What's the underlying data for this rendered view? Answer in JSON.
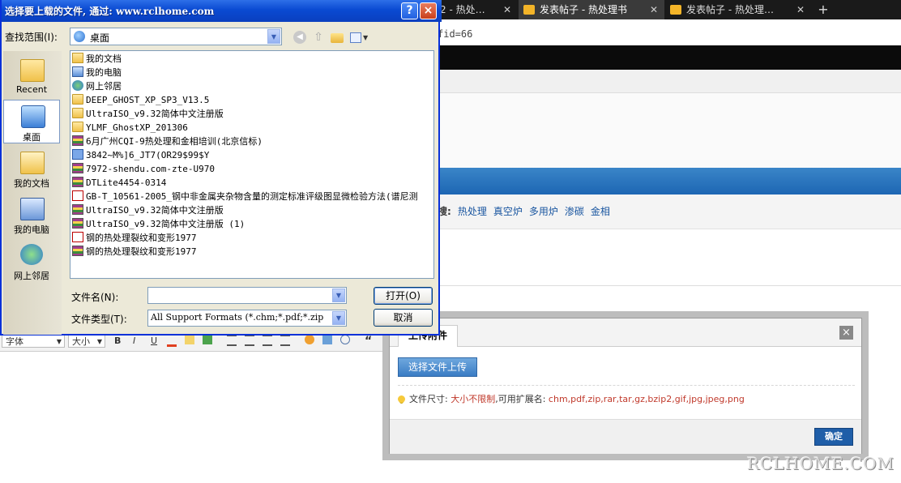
{
  "browser": {
    "tabs": [
      {
        "label": "2 - 热处…",
        "active": false
      },
      {
        "label": "发表帖子 - 热处理书",
        "active": true
      },
      {
        "label": "发表帖子 - 热处理…",
        "active": false
      }
    ],
    "new_tab": "+",
    "address_fragment": "fid=66"
  },
  "page": {
    "tags_label": "搜:",
    "tags": [
      "热处理",
      "真空炉",
      "多用炉",
      "渗碳",
      "金相"
    ],
    "editor_toolbar": {
      "font": "字体",
      "size": "大小",
      "bold": "B",
      "italic": "I",
      "underline": "U",
      "quote": "“"
    }
  },
  "upload_popup": {
    "tab_label": "上传附件",
    "close": "×",
    "select_button": "选择文件上传",
    "size_label": "文件尺寸:",
    "size_value": "大小不限制",
    "ext_label": ",可用扩展名:",
    "ext_value": "chm,pdf,zip,rar,tar,gz,bzip2,gif,jpg,jpeg,png",
    "ok_button": "确定"
  },
  "dialog": {
    "title": "选择要上载的文件, 通过: www.rclhome.com",
    "help": "?",
    "close": "×",
    "lookin_label": "查找范围(I):",
    "lookin_value": "桌面",
    "places": [
      {
        "label": "Recent",
        "icon": "recent-folder-icon"
      },
      {
        "label": "桌面",
        "icon": "desktop-icon",
        "selected": true
      },
      {
        "label": "我的文档",
        "icon": "my-documents-icon"
      },
      {
        "label": "我的电脑",
        "icon": "my-computer-icon"
      },
      {
        "label": "网上邻居",
        "icon": "network-icon"
      }
    ],
    "files": [
      {
        "name": "我的文档",
        "icon": "mydocs"
      },
      {
        "name": "我的电脑",
        "icon": "computer"
      },
      {
        "name": "网上邻居",
        "icon": "network"
      },
      {
        "name": "DEEP_GHOST_XP_SP3_V13.5",
        "icon": "folder"
      },
      {
        "name": "UltraISO_v9.32简体中文注册版",
        "icon": "folder"
      },
      {
        "name": "YLMF_GhostXP_201306",
        "icon": "folder"
      },
      {
        "name": "6月广州CQI-9热处理和金相培训(北京信标)",
        "icon": "archive"
      },
      {
        "name": "3842~M%]6_JT7(OR29$99$Y",
        "icon": "jpg"
      },
      {
        "name": "7972-shendu.com-zte-U970",
        "icon": "archive"
      },
      {
        "name": "DTLite4454-0314",
        "icon": "archive"
      },
      {
        "name": "GB-T_10561-2005_钢中非金属夹杂物含量的测定标准评级图显微检验方法(谱尼测",
        "icon": "pdf"
      },
      {
        "name": "UltraISO_v9.32简体中文注册版",
        "icon": "archive"
      },
      {
        "name": "UltraISO_v9.32简体中文注册版 (1)",
        "icon": "archive"
      },
      {
        "name": "钢的热处理裂纹和变形1977",
        "icon": "pdf"
      },
      {
        "name": "钢的热处理裂纹和变形1977",
        "icon": "archive"
      }
    ],
    "filename_label": "文件名(N):",
    "filename_value": "",
    "filetype_label": "文件类型(T):",
    "filetype_value": "All Support Formats (*.chm;*.pdf;*.zip",
    "open_button": "打开(O)",
    "cancel_button": "取消"
  },
  "watermark": "RCLHOME.COM"
}
